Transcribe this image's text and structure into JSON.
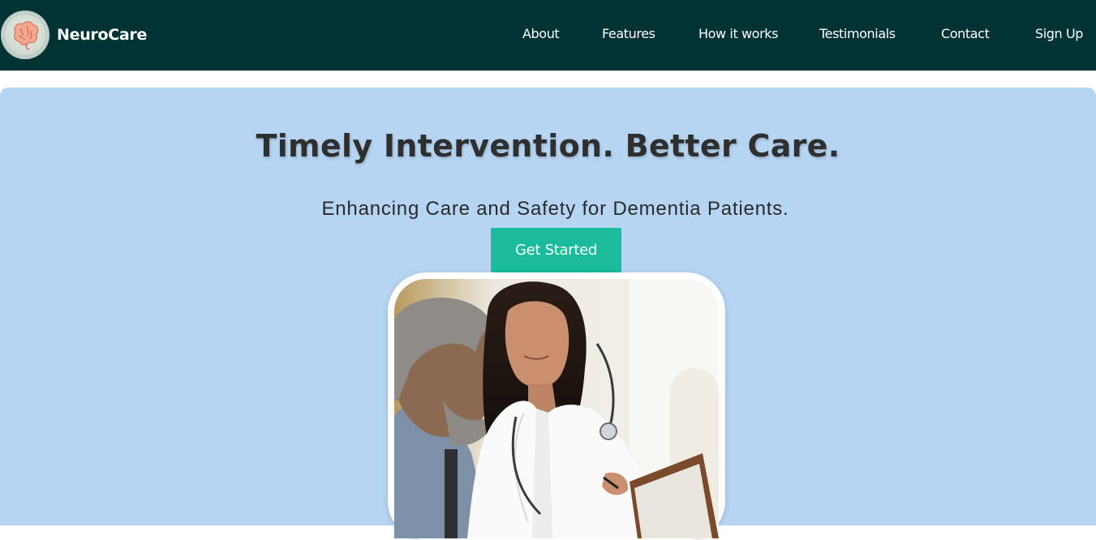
{
  "brand": {
    "name": "NeuroCare",
    "logo_icon": "brain-icon"
  },
  "nav": {
    "items": [
      {
        "label": "About"
      },
      {
        "label": "Features"
      },
      {
        "label": "How it works"
      },
      {
        "label": "Testimonials"
      },
      {
        "label": "Contact"
      },
      {
        "label": "Sign Up"
      }
    ]
  },
  "hero": {
    "title": "Timely Intervention. Better Care.",
    "subtitle": "Enhancing Care and Safety for Dementia Patients.",
    "cta_label": "Get Started",
    "image_subject": "doctor-with-elderly-patient-photo"
  },
  "colors": {
    "navbar_bg": "#013334",
    "hero_bg": "#b5d5f3",
    "cta_bg": "#1abc9c",
    "title_text": "#2f2f2f"
  }
}
